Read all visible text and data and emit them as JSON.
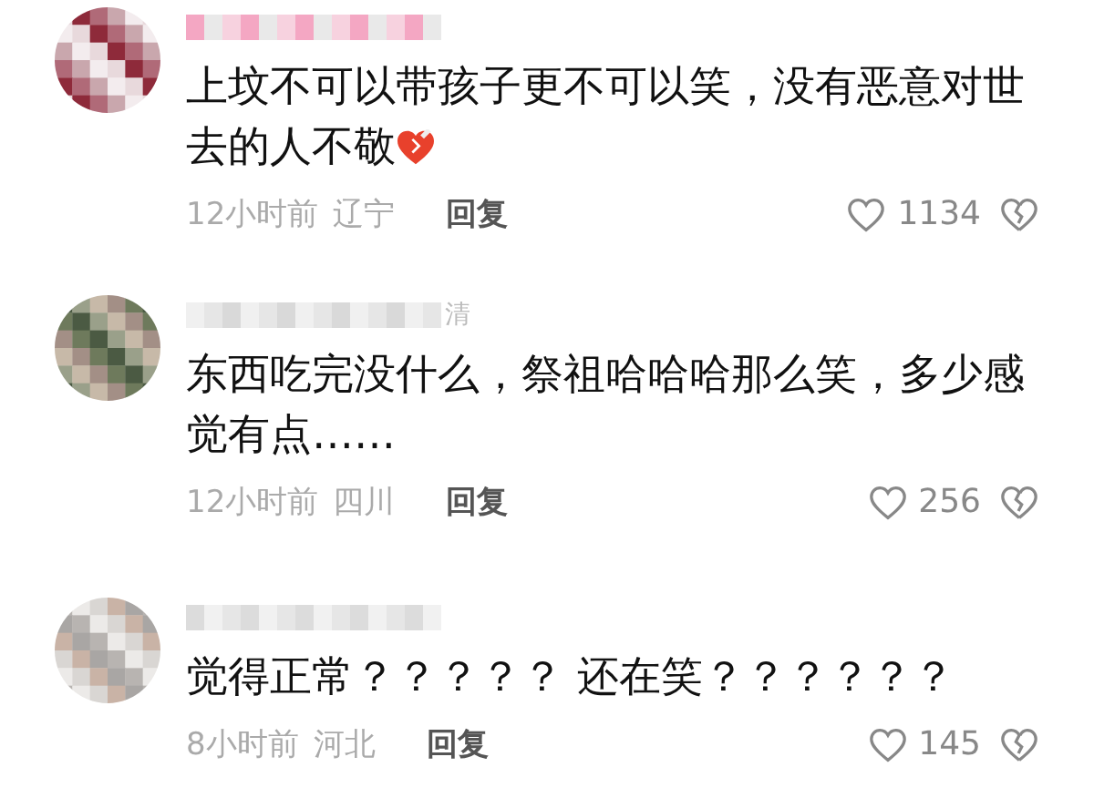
{
  "comments": [
    {
      "text": "上坟不可以带孩子更不可以笑，没有恶意对世去的人不敬",
      "emoji": true,
      "time": "12小时前",
      "location": "辽宁",
      "reply": "回复",
      "likes": "1134"
    },
    {
      "name_visible": "清",
      "text": "东西吃完没什么，祭祖哈哈哈那么笑，多少感觉有点……",
      "emoji": false,
      "time": "12小时前",
      "location": "四川",
      "reply": "回复",
      "likes": "256"
    },
    {
      "text": "觉得正常？？？？？ 还在笑？？？？？？",
      "emoji": false,
      "time": "8小时前",
      "location": "河北",
      "reply": "回复",
      "likes": "145"
    }
  ]
}
